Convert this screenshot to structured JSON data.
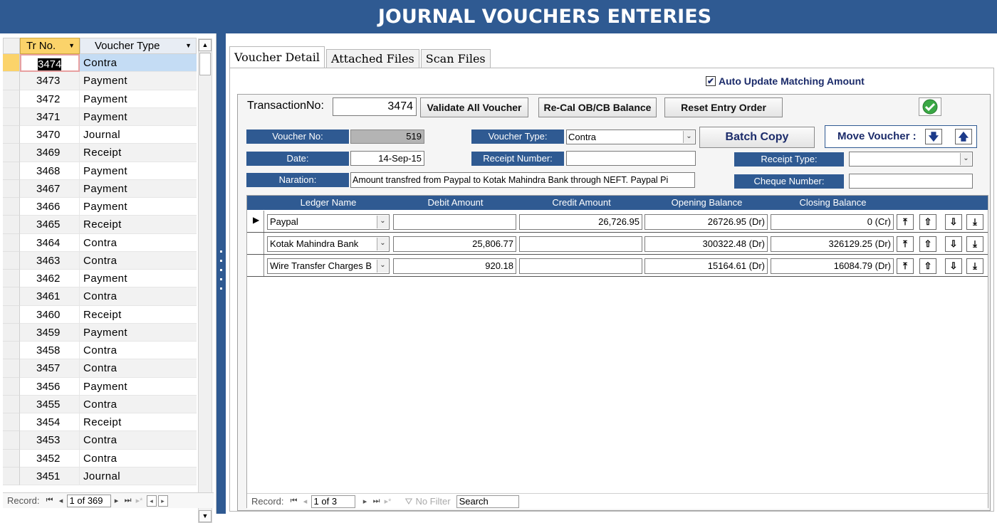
{
  "title": "JOURNAL VOUCHERS ENTERIES",
  "list": {
    "col_tr": "Tr No.",
    "col_type": "Voucher Type",
    "rows": [
      {
        "tr": "3474",
        "type": "Contra"
      },
      {
        "tr": "3473",
        "type": "Payment"
      },
      {
        "tr": "3472",
        "type": "Payment"
      },
      {
        "tr": "3471",
        "type": "Payment"
      },
      {
        "tr": "3470",
        "type": "Journal"
      },
      {
        "tr": "3469",
        "type": "Receipt"
      },
      {
        "tr": "3468",
        "type": "Payment"
      },
      {
        "tr": "3467",
        "type": "Payment"
      },
      {
        "tr": "3466",
        "type": "Payment"
      },
      {
        "tr": "3465",
        "type": "Receipt"
      },
      {
        "tr": "3464",
        "type": "Contra"
      },
      {
        "tr": "3463",
        "type": "Contra"
      },
      {
        "tr": "3462",
        "type": "Payment"
      },
      {
        "tr": "3461",
        "type": "Contra"
      },
      {
        "tr": "3460",
        "type": "Receipt"
      },
      {
        "tr": "3459",
        "type": "Payment"
      },
      {
        "tr": "3458",
        "type": "Contra"
      },
      {
        "tr": "3457",
        "type": "Contra"
      },
      {
        "tr": "3456",
        "type": "Payment"
      },
      {
        "tr": "3455",
        "type": "Contra"
      },
      {
        "tr": "3454",
        "type": "Receipt"
      },
      {
        "tr": "3453",
        "type": "Contra"
      },
      {
        "tr": "3452",
        "type": "Contra"
      },
      {
        "tr": "3451",
        "type": "Journal"
      }
    ],
    "nav": {
      "label": "Record:",
      "position": "1 of 369"
    }
  },
  "tabs": [
    "Voucher Detail",
    "Attached Files",
    "Scan Files"
  ],
  "auto_update_label": "Auto Update Matching Amount",
  "auto_update_checked": true,
  "form": {
    "transaction_label": "TransactionNo:",
    "transaction_value": "3474",
    "validate_btn": "Validate All Voucher",
    "recal_btn": "Re-Cal OB/CB Balance",
    "reset_btn": "Reset Entry Order",
    "voucher_no_label": "Voucher No:",
    "voucher_no_value": "519",
    "voucher_type_label": "Voucher Type:",
    "voucher_type_value": "Contra",
    "batch_copy_btn": "Batch Copy",
    "move_voucher_label": "Move Voucher :",
    "date_label": "Date:",
    "date_value": "14-Sep-15",
    "receipt_number_label": "Receipt Number:",
    "receipt_number_value": "",
    "receipt_type_label": "Receipt Type:",
    "receipt_type_value": "",
    "naration_label": "Naration:",
    "naration_value": "Amount transfred from Paypal to Kotak Mahindra Bank through NEFT. Paypal Pi",
    "cheque_number_label": "Cheque Number:",
    "cheque_number_value": ""
  },
  "ledger": {
    "headers": [
      "Ledger Name",
      "Debit Amount",
      "Credit Amount",
      "Opening Balance",
      "Closing Balance"
    ],
    "rows": [
      {
        "name": "Paypal",
        "debit": "",
        "credit": "26,726.95",
        "opening": "26726.95 (Dr)",
        "closing": "0 (Cr)"
      },
      {
        "name": "Kotak Mahindra Bank",
        "debit": "25,806.77",
        "credit": "",
        "opening": "300322.48 (Dr)",
        "closing": "326129.25 (Dr)"
      },
      {
        "name": "Wire Transfer Charges B",
        "debit": "920.18",
        "credit": "",
        "opening": "15164.61 (Dr)",
        "closing": "16084.79 (Dr)"
      }
    ],
    "nav": {
      "label": "Record:",
      "position": "1 of 3",
      "no_filter": "No Filter",
      "search": "Search"
    }
  },
  "colors": {
    "header_blue": "#2f5a92",
    "selected_row": "#c4dcf4",
    "current_marker": "#fbd36a",
    "check_green": "#3aa845"
  }
}
